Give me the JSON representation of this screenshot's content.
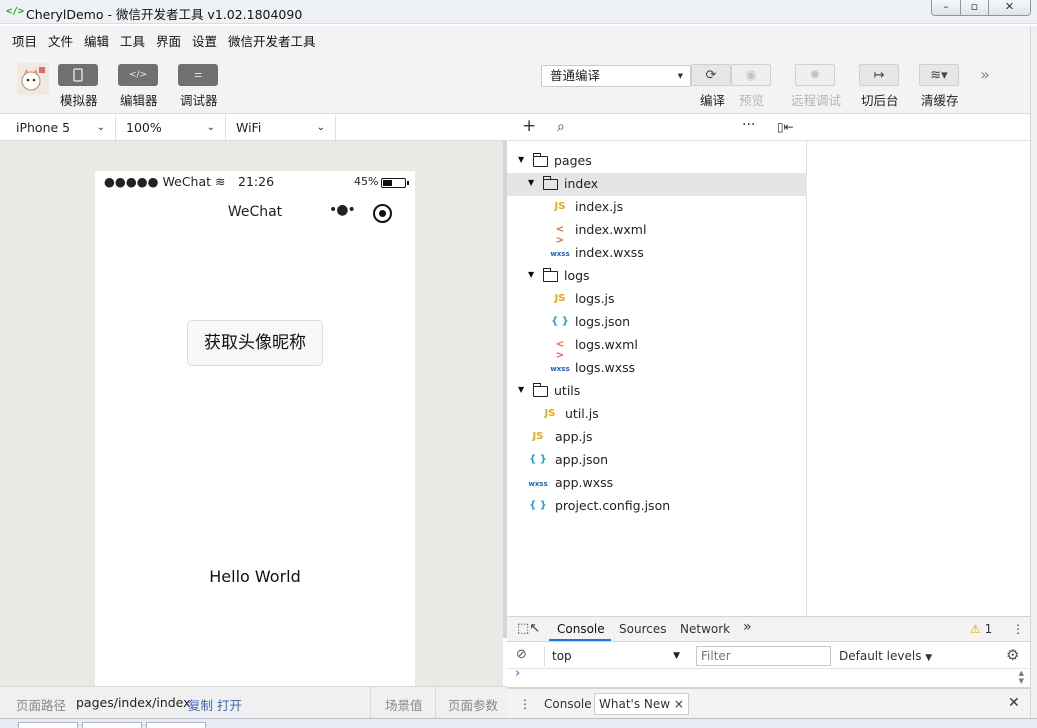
{
  "window": {
    "title": "CherylDemo - 微信开发者工具 v1.02.1804090",
    "app_icon": "</>"
  },
  "menu": [
    "项目",
    "文件",
    "编辑",
    "工具",
    "界面",
    "设置",
    "微信开发者工具"
  ],
  "toolbar": {
    "simulator": "模拟器",
    "editor": "编辑器",
    "debugger": "调试器",
    "compile_mode": "普通编译",
    "compile": "编译",
    "preview": "预览",
    "remote_debug": "远程调试",
    "background": "切后台",
    "clear_cache": "清缓存"
  },
  "device_bar": {
    "device": "iPhone 5",
    "zoom": "100%",
    "network": "WiFi"
  },
  "phone": {
    "carrier": "●●●●● WeChat",
    "time": "21:26",
    "battery": "45%",
    "nav_title": "WeChat",
    "nav_more": "•●•",
    "button": "获取头像昵称",
    "hello": "Hello World"
  },
  "file_tree": {
    "pages": "pages",
    "index": "index",
    "index_js": "index.js",
    "index_wxml": "index.wxml",
    "index_wxss": "index.wxss",
    "logs": "logs",
    "logs_js": "logs.js",
    "logs_json": "logs.json",
    "logs_wxml": "logs.wxml",
    "logs_wxss": "logs.wxss",
    "utils": "utils",
    "util_js": "util.js",
    "app_js": "app.js",
    "app_json": "app.json",
    "app_wxss": "app.wxss",
    "project_config": "project.config.json",
    "icon_js": "JS",
    "icon_wxml": "< >",
    "icon_wxss": "wxss",
    "icon_json": "{ }"
  },
  "devtools": {
    "tabs": [
      "Console",
      "Sources",
      "Network"
    ],
    "more": "»",
    "warnings": "1",
    "context": "top",
    "filter_placeholder": "Filter",
    "levels": "Default levels",
    "prompt": "›",
    "drawer_tabs": [
      "Console",
      "What's New"
    ]
  },
  "footer": {
    "path_label": "页面路径",
    "path": "pages/index/index",
    "copy": "复制",
    "open": "打开",
    "scene": "场景值",
    "params": "页面参数"
  }
}
